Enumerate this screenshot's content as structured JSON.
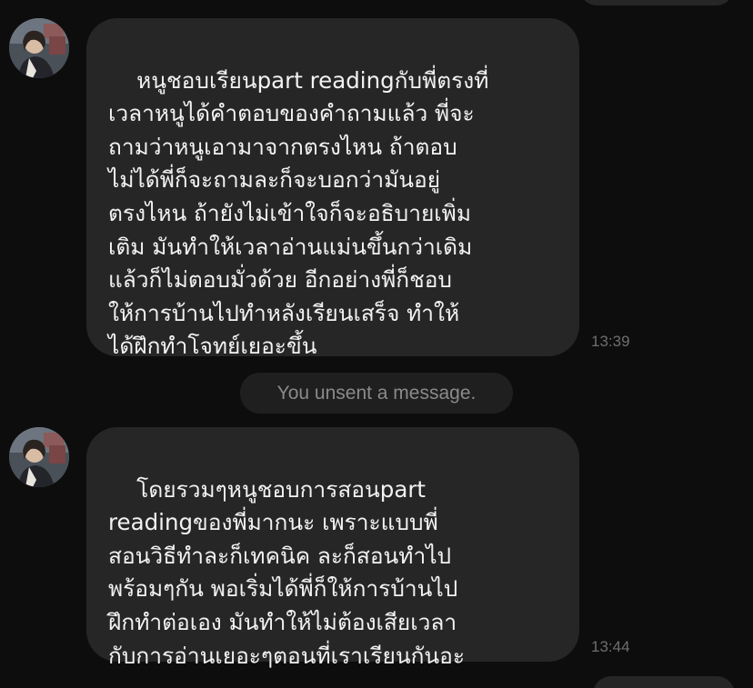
{
  "conversation": {
    "messages": [
      {
        "sender": "them",
        "text": "หนูชอบเรียนpart readingกับพี่ตรงที่\nเวลาหนูได้คำตอบของคำถามแล้ว พี่จะ\nถามว่าหนูเอามาจากตรงไหน ถ้าตอบ\nไม่ได้พี่ก็จะถามละก็จะบอกว่ามันอยู่\nตรงไหน ถ้ายังไม่เข้าใจก็จะอธิบายเพิ่ม\nเติม มันทำให้เวลาอ่านแม่นขึ้นกว่าเดิม\nแล้วก็ไม่ตอบมั่วด้วย อีกอย่างพี่ก็ชอบ\nให้การบ้านไปทำหลังเรียนเสร็จ ทำให้\nได้ฝึกทำโจทย์เยอะขึ้น",
        "time": "13:39"
      },
      {
        "sender": "them",
        "text": "โดยรวมๆหนูชอบการสอนpart\nreadingของพี่มากนะ เพราะแบบพี่\nสอนวิธีทำละก็เทคนิค ละก็สอนทำไป\nพร้อมๆกัน พอเริ่มได้พี่ก็ให้การบ้านไป\nฝึกทำต่อเอง มันทำให้ไม่ต้องเสียเวลา\nกับการอ่านเยอะๆตอนที่เราเรียนกันอะ",
        "time": "13:44"
      }
    ],
    "system_notice": "You unsent a message."
  },
  "colors": {
    "background": "#0d0d0d",
    "bubble": "#262626",
    "text": "#f2f2f2",
    "timestamp": "#6e6e6e",
    "notice_text": "#8a8a8a"
  }
}
